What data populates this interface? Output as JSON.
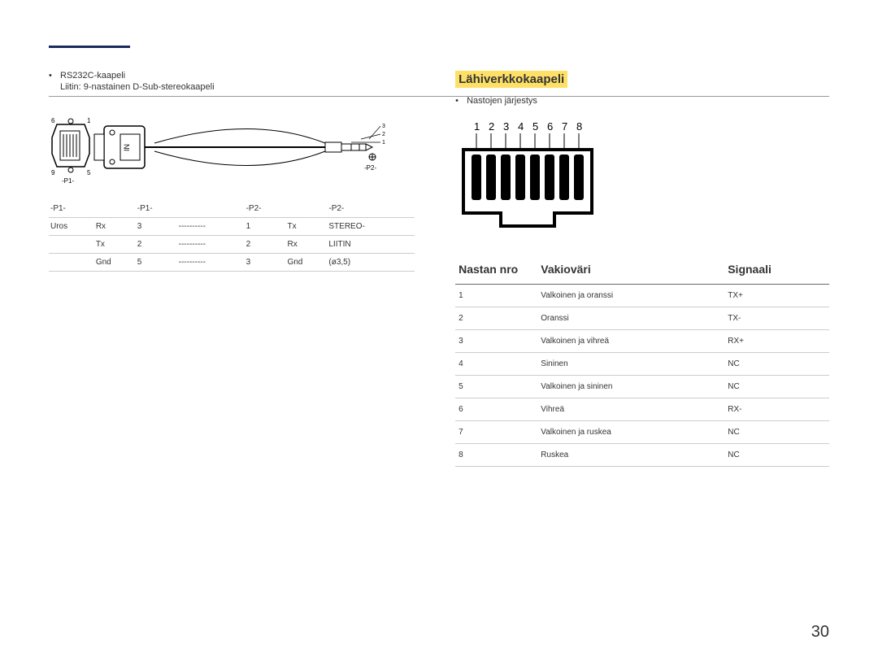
{
  "left": {
    "cable_name": "RS232C-kaapeli",
    "cable_desc": "Liitin: 9-nastainen D-Sub-stereokaapeli",
    "diagram": {
      "p1_label": "-P1-",
      "p2_label": "-P2-",
      "dsub_pins": [
        "1",
        "5",
        "6",
        "9"
      ],
      "trs_pins": [
        "1",
        "2",
        "3"
      ],
      "in_label": "IN"
    },
    "table": {
      "headers": [
        "-P1-",
        "",
        "-P1-",
        "",
        "-P2-",
        "",
        "-P2-"
      ],
      "rows": [
        [
          "Uros",
          "Rx",
          "3",
          "----------",
          "1",
          "Tx",
          "STEREO-"
        ],
        [
          "",
          "Tx",
          "2",
          "----------",
          "2",
          "Rx",
          "LIITIN"
        ],
        [
          "",
          "Gnd",
          "5",
          "----------",
          "3",
          "Gnd",
          "(ø3,5)"
        ]
      ]
    }
  },
  "right": {
    "title": "Lähiverkkokaapeli",
    "pin_order": "Nastojen järjestys",
    "pins": [
      "1",
      "2",
      "3",
      "4",
      "5",
      "6",
      "7",
      "8"
    ],
    "table": {
      "headers": {
        "pin": "Nastan nro",
        "color": "Vakioväri",
        "signal": "Signaali"
      },
      "rows": [
        {
          "pin": "1",
          "color": "Valkoinen ja oranssi",
          "signal": "TX+"
        },
        {
          "pin": "2",
          "color": "Oranssi",
          "signal": "TX-"
        },
        {
          "pin": "3",
          "color": "Valkoinen ja vihreä",
          "signal": "RX+"
        },
        {
          "pin": "4",
          "color": "Sininen",
          "signal": "NC"
        },
        {
          "pin": "5",
          "color": "Valkoinen ja sininen",
          "signal": "NC"
        },
        {
          "pin": "6",
          "color": "Vihreä",
          "signal": "RX-"
        },
        {
          "pin": "7",
          "color": "Valkoinen ja ruskea",
          "signal": "NC"
        },
        {
          "pin": "8",
          "color": "Ruskea",
          "signal": "NC"
        }
      ]
    }
  },
  "page_number": "30"
}
